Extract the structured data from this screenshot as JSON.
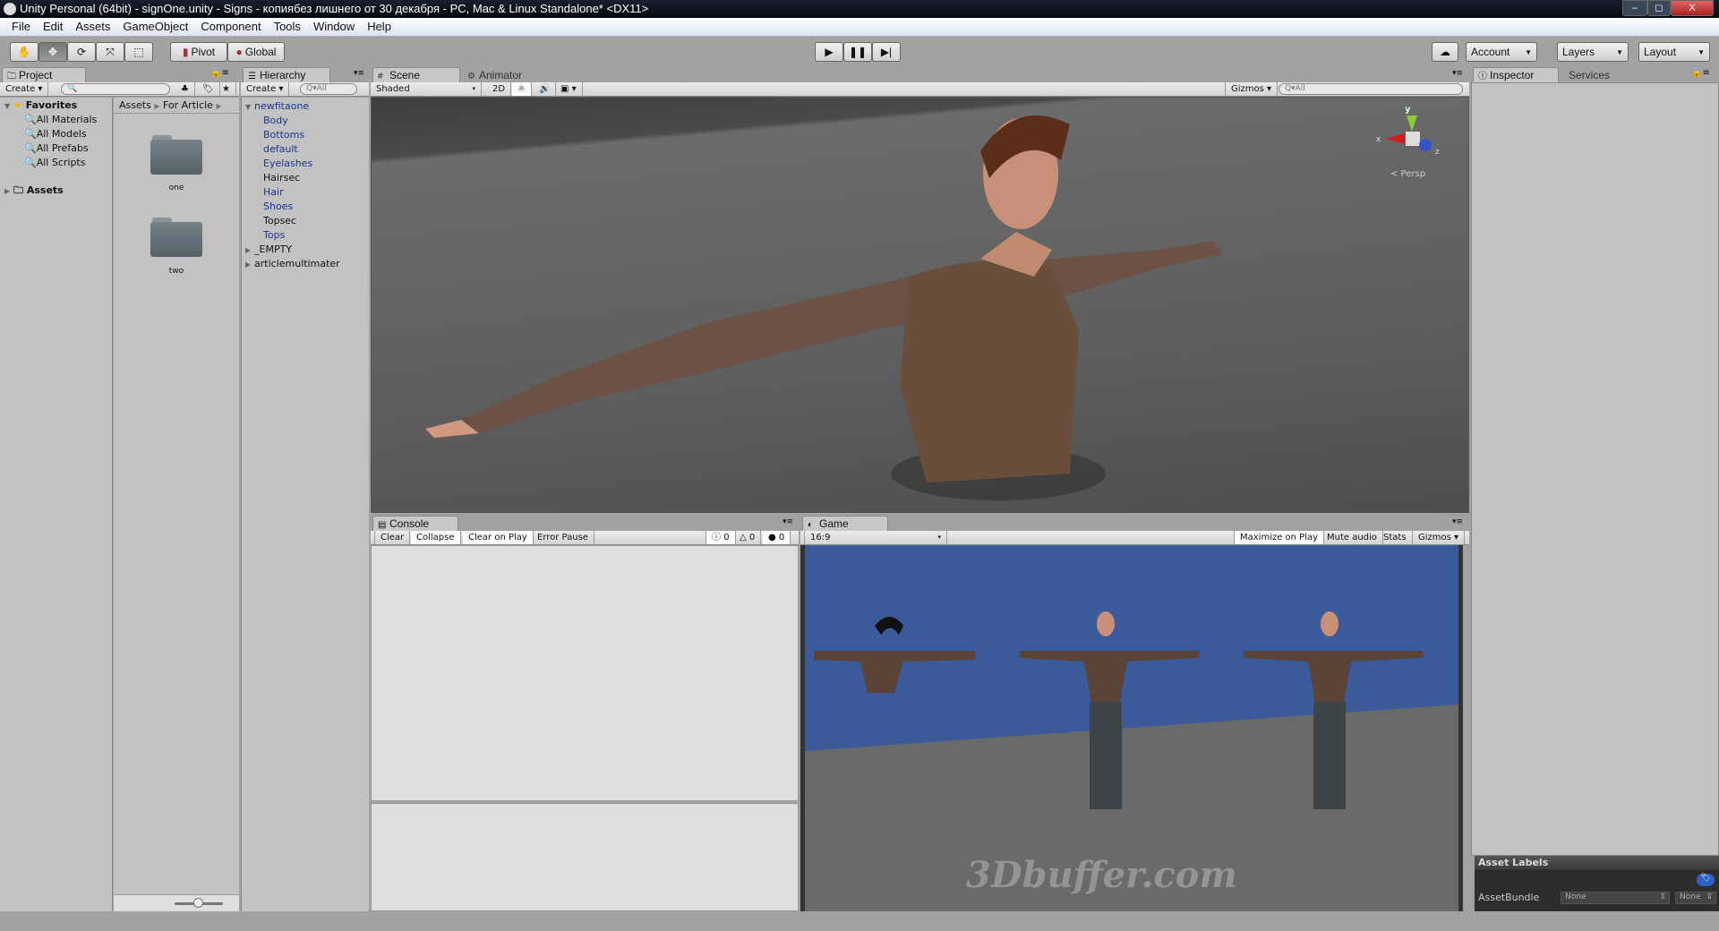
{
  "window": {
    "title": "Unity Personal (64bit) - signOne.unity - Signs - копиябез лишнего от 30 декабря - PC, Mac & Linux Standalone* <DX11>",
    "minimize": "–",
    "restore": "◻",
    "close": "X"
  },
  "menu": [
    "File",
    "Edit",
    "Assets",
    "GameObject",
    "Component",
    "Tools",
    "Window",
    "Help"
  ],
  "toolbar": {
    "tools": [
      "hand-tool",
      "move-tool",
      "rotate-tool",
      "scale-tool",
      "rect-tool"
    ],
    "pivot": "Pivot",
    "global": "Global",
    "account": "Account",
    "layers": "Layers",
    "layout": "Layout"
  },
  "project": {
    "tab": "Project",
    "create": "Create",
    "favorites": "Favorites",
    "favorite_items": [
      "All Materials",
      "All Models",
      "All Prefabs",
      "All Scripts"
    ],
    "assets": "Assets",
    "breadcrumb": [
      "Assets",
      "For Article"
    ],
    "folders": [
      "one",
      "two"
    ],
    "slider_value": 0.5
  },
  "hierarchy": {
    "tab": "Hierarchy",
    "create": "Create",
    "search_placeholder": "Q▾All",
    "root": "newfitaone",
    "children": [
      {
        "name": "Body",
        "prefab": true
      },
      {
        "name": "Bottoms",
        "prefab": true
      },
      {
        "name": "default",
        "prefab": true
      },
      {
        "name": "Eyelashes",
        "prefab": true
      },
      {
        "name": "Hairsec",
        "prefab": false
      },
      {
        "name": "Hair",
        "prefab": true
      },
      {
        "name": "Shoes",
        "prefab": true
      },
      {
        "name": "Topsec",
        "prefab": false
      },
      {
        "name": "Tops",
        "prefab": true
      }
    ],
    "others": [
      "_EMPTY",
      "articlemultimater"
    ]
  },
  "scene": {
    "tab": "Scene",
    "tab2": "Animator",
    "shading": "Shaded",
    "mode2d": "2D",
    "gizmos": "Gizmos",
    "search_placeholder": "Q▾All",
    "persp": "< Persp",
    "axes": {
      "y": "y",
      "x": "x",
      "z": "z"
    }
  },
  "console": {
    "tab": "Console",
    "clear": "Clear",
    "collapse": "Collapse",
    "clear_on_play": "Clear on Play",
    "error_pause": "Error Pause",
    "info_count": "0",
    "warn_count": "0",
    "error_count": "0"
  },
  "game": {
    "tab": "Game",
    "aspect": "16:9",
    "maximize": "Maximize on Play",
    "mute": "Mute audio",
    "stats": "Stats",
    "gizmos": "Gizmos",
    "watermark": "3Dbuffer.com"
  },
  "inspector": {
    "tab": "Inspector",
    "tab2": "Services",
    "asset_labels": "Asset Labels",
    "asset_bundle": "AssetBundle",
    "bundle_value": "None",
    "variant_value": "None"
  }
}
